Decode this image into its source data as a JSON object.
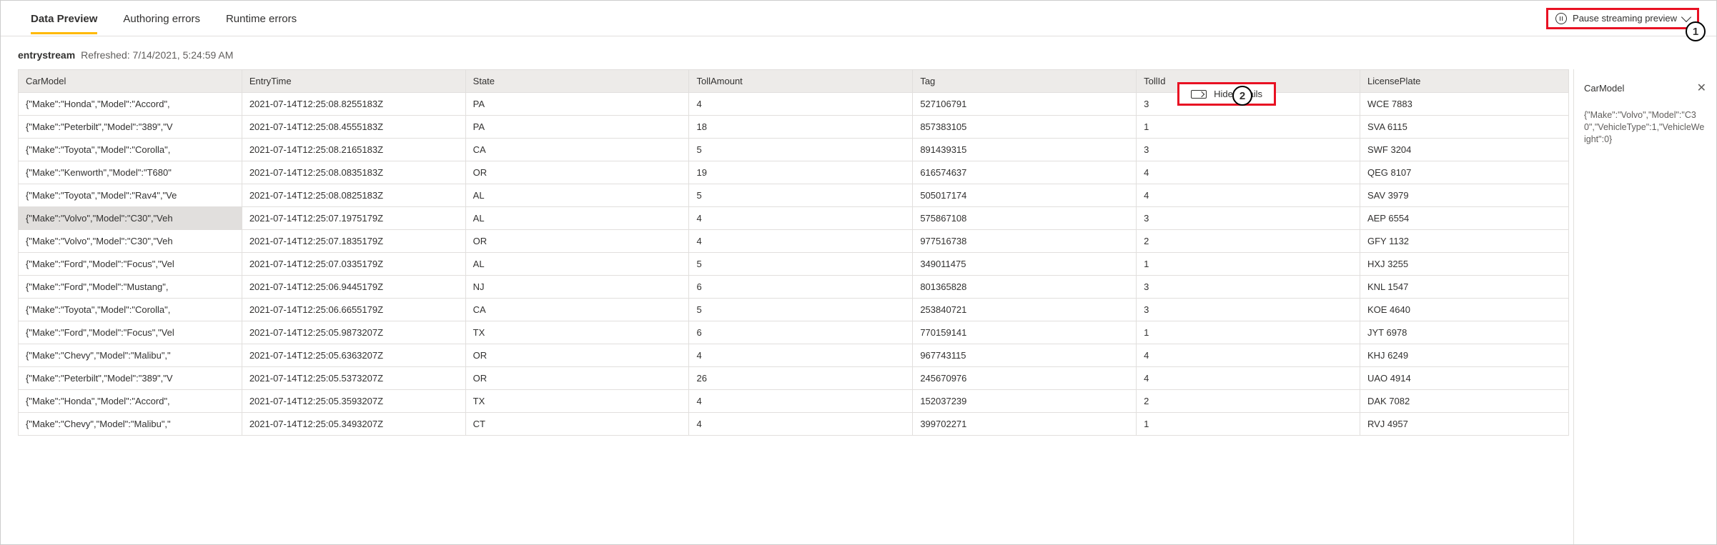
{
  "tabs": {
    "data_preview": "Data Preview",
    "authoring_errors": "Authoring errors",
    "runtime_errors": "Runtime errors"
  },
  "pause_button": {
    "label": "Pause streaming preview"
  },
  "callouts": {
    "one": "1",
    "two": "2"
  },
  "stream": {
    "name": "entrystream",
    "refreshed_label": "Refreshed: 7/14/2021, 5:24:59 AM"
  },
  "hide_details": {
    "label": "Hide details"
  },
  "details": {
    "title": "CarModel",
    "body": "{\"Make\":\"Volvo\",\"Model\":\"C30\",\"VehicleType\":1,\"VehicleWeight\":0}"
  },
  "columns": {
    "car_model": "CarModel",
    "entry_time": "EntryTime",
    "state": "State",
    "toll_amount": "TollAmount",
    "tag": "Tag",
    "toll_id": "TollId",
    "license_plate": "LicensePlate"
  },
  "rows": [
    {
      "car_model": "{\"Make\":\"Honda\",\"Model\":\"Accord\",",
      "entry_time": "2021-07-14T12:25:08.8255183Z",
      "state": "PA",
      "toll_amount": "4",
      "tag": "527106791",
      "toll_id": "3",
      "license_plate": "WCE 7883"
    },
    {
      "car_model": "{\"Make\":\"Peterbilt\",\"Model\":\"389\",\"V",
      "entry_time": "2021-07-14T12:25:08.4555183Z",
      "state": "PA",
      "toll_amount": "18",
      "tag": "857383105",
      "toll_id": "1",
      "license_plate": "SVA 6115"
    },
    {
      "car_model": "{\"Make\":\"Toyota\",\"Model\":\"Corolla\",",
      "entry_time": "2021-07-14T12:25:08.2165183Z",
      "state": "CA",
      "toll_amount": "5",
      "tag": "891439315",
      "toll_id": "3",
      "license_plate": "SWF 3204"
    },
    {
      "car_model": "{\"Make\":\"Kenworth\",\"Model\":\"T680\"",
      "entry_time": "2021-07-14T12:25:08.0835183Z",
      "state": "OR",
      "toll_amount": "19",
      "tag": "616574637",
      "toll_id": "4",
      "license_plate": "QEG 8107"
    },
    {
      "car_model": "{\"Make\":\"Toyota\",\"Model\":\"Rav4\",\"Ve",
      "entry_time": "2021-07-14T12:25:08.0825183Z",
      "state": "AL",
      "toll_amount": "5",
      "tag": "505017174",
      "toll_id": "4",
      "license_plate": "SAV 3979"
    },
    {
      "car_model": "{\"Make\":\"Volvo\",\"Model\":\"C30\",\"Veh",
      "entry_time": "2021-07-14T12:25:07.1975179Z",
      "state": "AL",
      "toll_amount": "4",
      "tag": "575867108",
      "toll_id": "3",
      "license_plate": "AEP 6554"
    },
    {
      "car_model": "{\"Make\":\"Volvo\",\"Model\":\"C30\",\"Veh",
      "entry_time": "2021-07-14T12:25:07.1835179Z",
      "state": "OR",
      "toll_amount": "4",
      "tag": "977516738",
      "toll_id": "2",
      "license_plate": "GFY 1132"
    },
    {
      "car_model": "{\"Make\":\"Ford\",\"Model\":\"Focus\",\"Vel",
      "entry_time": "2021-07-14T12:25:07.0335179Z",
      "state": "AL",
      "toll_amount": "5",
      "tag": "349011475",
      "toll_id": "1",
      "license_plate": "HXJ 3255"
    },
    {
      "car_model": "{\"Make\":\"Ford\",\"Model\":\"Mustang\",",
      "entry_time": "2021-07-14T12:25:06.9445179Z",
      "state": "NJ",
      "toll_amount": "6",
      "tag": "801365828",
      "toll_id": "3",
      "license_plate": "KNL 1547"
    },
    {
      "car_model": "{\"Make\":\"Toyota\",\"Model\":\"Corolla\",",
      "entry_time": "2021-07-14T12:25:06.6655179Z",
      "state": "CA",
      "toll_amount": "5",
      "tag": "253840721",
      "toll_id": "3",
      "license_plate": "KOE 4640"
    },
    {
      "car_model": "{\"Make\":\"Ford\",\"Model\":\"Focus\",\"Vel",
      "entry_time": "2021-07-14T12:25:05.9873207Z",
      "state": "TX",
      "toll_amount": "6",
      "tag": "770159141",
      "toll_id": "1",
      "license_plate": "JYT 6978"
    },
    {
      "car_model": "{\"Make\":\"Chevy\",\"Model\":\"Malibu\",\"",
      "entry_time": "2021-07-14T12:25:05.6363207Z",
      "state": "OR",
      "toll_amount": "4",
      "tag": "967743115",
      "toll_id": "4",
      "license_plate": "KHJ 6249"
    },
    {
      "car_model": "{\"Make\":\"Peterbilt\",\"Model\":\"389\",\"V",
      "entry_time": "2021-07-14T12:25:05.5373207Z",
      "state": "OR",
      "toll_amount": "26",
      "tag": "245670976",
      "toll_id": "4",
      "license_plate": "UAO 4914"
    },
    {
      "car_model": "{\"Make\":\"Honda\",\"Model\":\"Accord\",",
      "entry_time": "2021-07-14T12:25:05.3593207Z",
      "state": "TX",
      "toll_amount": "4",
      "tag": "152037239",
      "toll_id": "2",
      "license_plate": "DAK 7082"
    },
    {
      "car_model": "{\"Make\":\"Chevy\",\"Model\":\"Malibu\",\"",
      "entry_time": "2021-07-14T12:25:05.3493207Z",
      "state": "CT",
      "toll_amount": "4",
      "tag": "399702271",
      "toll_id": "1",
      "license_plate": "RVJ 4957"
    }
  ]
}
